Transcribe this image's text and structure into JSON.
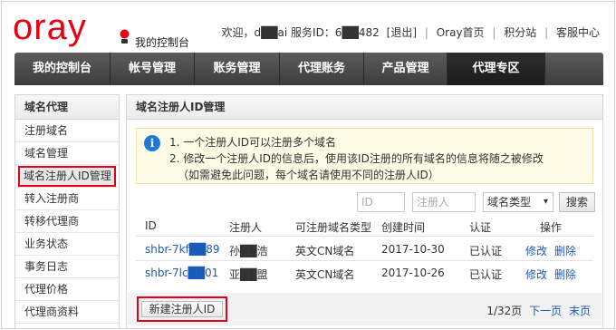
{
  "header": {
    "logo": "oray",
    "console_label": "我的控制台",
    "welcome": "欢迎，d██ai 服务ID：6██482",
    "logout": "[退出]",
    "links": [
      "Oray首页",
      "积分站",
      "客服中心"
    ]
  },
  "nav": {
    "items": [
      "我的控制台",
      "帐号管理",
      "账务管理",
      "代理账务",
      "产品管理",
      "代理专区"
    ],
    "active_index": 5
  },
  "sidebar": {
    "title": "域名代理",
    "items": [
      "注册域名",
      "域名管理",
      "域名注册人ID管理",
      "转入注册商",
      "转移代理商",
      "业务状态",
      "事务日志",
      "代理价格",
      "代理商资料"
    ],
    "current_index": 2
  },
  "main": {
    "title": "域名注册人ID管理",
    "notice": {
      "line1": "1. 一个注册人ID可以注册多个域名",
      "line2": "2. 修改一个注册人ID的信息后，使用该ID注册的所有域名的信息将随之被修改",
      "line3": "（如需避免此问题，每个域名请使用不同的注册人ID）"
    },
    "filter": {
      "id_placeholder": "ID",
      "registrant_placeholder": "注册人",
      "domain_type": "域名类型",
      "search_button": "搜索"
    },
    "table": {
      "headers": [
        "ID",
        "注册人",
        "可注册域名类型",
        "创建时间",
        "认证",
        "操作"
      ],
      "rows": [
        {
          "id": "shbr-7kf██89",
          "registrant": "孙██浩",
          "type": "英文CN域名",
          "created": "2017-10-30",
          "auth": "已认证",
          "edit": "修改",
          "delete": "删除"
        },
        {
          "id": "shbr-7lc██01",
          "registrant": "亚██盟",
          "type": "英文CN域名",
          "created": "2017-10-26",
          "auth": "已认证",
          "edit": "修改",
          "delete": "删除"
        }
      ]
    },
    "new_button": "新建注册人ID",
    "pager": {
      "info": "1/32页",
      "next": "下一页",
      "last": "末页"
    }
  },
  "colors": {
    "brand": "#e60012",
    "link": "#1a5ab8",
    "highlight": "#e3001b"
  }
}
